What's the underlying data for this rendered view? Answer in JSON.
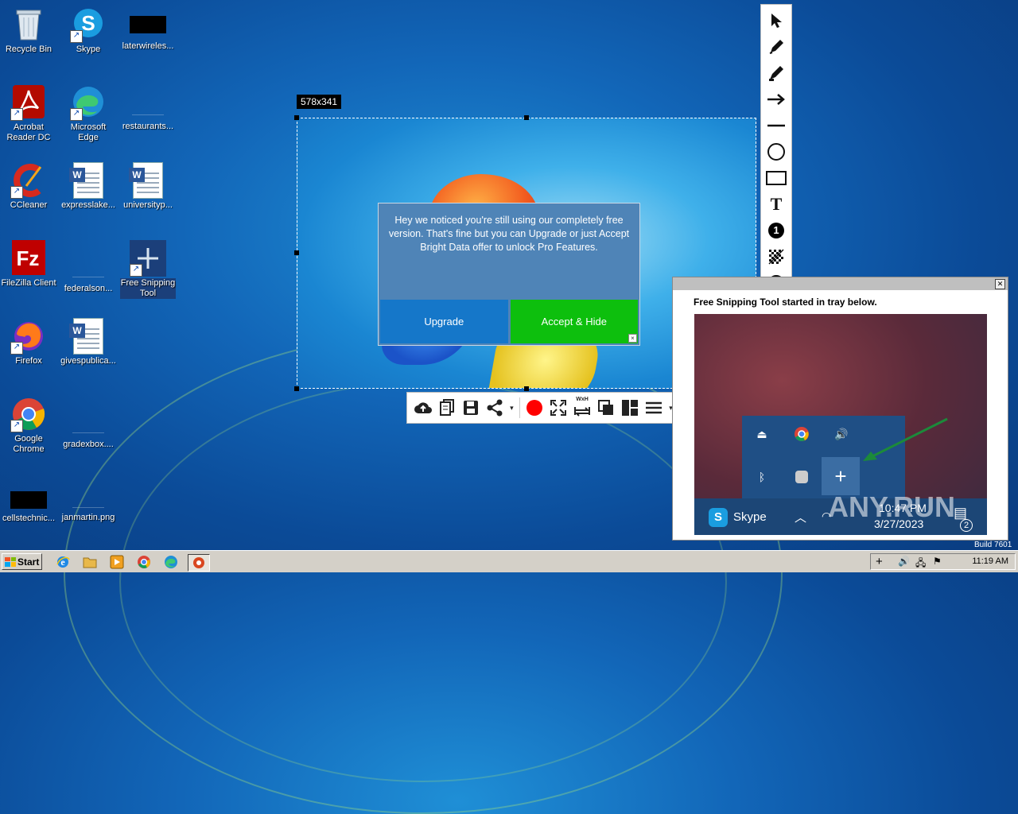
{
  "desktop": {
    "icons": [
      {
        "label": "Recycle Bin"
      },
      {
        "label": "Skype"
      },
      {
        "label": "laterwireles..."
      },
      {
        "label": "Acrobat Reader DC"
      },
      {
        "label": "Microsoft Edge"
      },
      {
        "label": "restaurants..."
      },
      {
        "label": "CCleaner"
      },
      {
        "label": "expresslake..."
      },
      {
        "label": "universityp..."
      },
      {
        "label": "FileZilla Client"
      },
      {
        "label": "federalson..."
      },
      {
        "label": "Free Snipping Tool"
      },
      {
        "label": "Firefox"
      },
      {
        "label": "givespublica..."
      },
      {
        "label": "Google Chrome"
      },
      {
        "label": "gradexbox...."
      },
      {
        "label": "cellstechnic..."
      },
      {
        "label": "janmartin.png"
      }
    ]
  },
  "capture": {
    "size_label": "578x341"
  },
  "popup": {
    "message": "Hey we noticed you're still using our completely free version. That's fine but you can Upgrade or just Accept Bright Data offer to unlock Pro Features.",
    "upgrade_label": "Upgrade",
    "accept_label": "Accept & Hide",
    "close_glyph": "×"
  },
  "toolbar": {
    "icons": [
      "cloud-upload-icon",
      "copy-icon",
      "save-icon",
      "share-icon",
      "record-icon",
      "fullscreen-icon",
      "resize-icon",
      "windows-icon",
      "layout-icon",
      "menu-icon",
      "settings-icon",
      "lock-icon",
      "close-icon"
    ],
    "resize_label": "WxH"
  },
  "palette": {
    "tools": [
      "select",
      "pen",
      "marker",
      "arrow",
      "line",
      "ellipse",
      "rectangle",
      "text",
      "number",
      "blur",
      "emoji",
      "color-picker",
      "color",
      "undo",
      "redo"
    ],
    "text_glyph": "T",
    "number_glyph": "1",
    "color": "#2d8cff"
  },
  "notification": {
    "text": "Free Snipping Tool started in tray below.",
    "skype_label": "Skype",
    "time": "10:47 PM",
    "date": "3/27/2023",
    "notif_count": "2",
    "watermark": "ANY.RUN"
  },
  "taskbar": {
    "start_label": "Start",
    "clock": "11:19 AM",
    "build": "Build 7601"
  }
}
